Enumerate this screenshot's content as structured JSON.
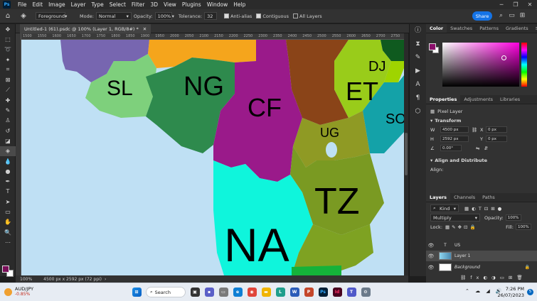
{
  "app": {
    "icon": "Ps",
    "menu": [
      "File",
      "Edit",
      "Image",
      "Layer",
      "Type",
      "Select",
      "Filter",
      "3D",
      "View",
      "Plugins",
      "Window",
      "Help"
    ]
  },
  "options": {
    "sample": "Foreground",
    "mode_label": "Mode:",
    "mode_value": "Normal",
    "opacity_label": "Opacity:",
    "opacity_value": "100%",
    "tolerance_label": "Tolerance:",
    "tolerance_value": "32",
    "antialias": "Anti-alias",
    "contiguous": "Contiguous",
    "all_layers": "All Layers",
    "share": "Share"
  },
  "document": {
    "tab_title": "Untitled-1 (61).psdc @ 100% (Layer 1, RGB/8#) *",
    "zoom": "100%",
    "info": "4500 px x 2592 px (72 ppi)"
  },
  "ruler_ticks": [
    "1500",
    "1550",
    "1600",
    "1650",
    "1700",
    "1750",
    "1800",
    "1850",
    "1900",
    "1950",
    "2000",
    "2050",
    "2100",
    "2150",
    "2200",
    "2250",
    "2300",
    "2350",
    "2400",
    "2450",
    "2500",
    "2550",
    "2600",
    "2650",
    "2700",
    "2750"
  ],
  "map_labels": [
    "SL",
    "NG",
    "CF",
    "ET",
    "DJ",
    "SO",
    "UG",
    "TZ",
    "NA"
  ],
  "colors": {
    "accent": "#1473e6",
    "foreground": "#8b0e6b",
    "background": "#ffffff"
  },
  "color_panel": {
    "tabs": [
      "Color",
      "Swatches",
      "Patterns",
      "Gradients"
    ]
  },
  "properties": {
    "tabs": [
      "Properties",
      "Adjustments",
      "Libraries"
    ],
    "layer_type": "Pixel Layer",
    "transform_label": "Transform",
    "w_label": "W",
    "w_value": "4500 px",
    "h_label": "H",
    "h_value": "2592 px",
    "x_label": "X",
    "x_value": "0 px",
    "y_label": "Y",
    "y_value": "0 px",
    "angle": "0.00°",
    "align_label": "Align and Distribute",
    "align_sub": "Align:"
  },
  "layers_panel": {
    "tabs": [
      "Layers",
      "Channels",
      "Paths"
    ],
    "kind": "Kind",
    "blend": "Multiply",
    "opacity_label": "Opacity:",
    "opacity_value": "100%",
    "lock_label": "Lock:",
    "fill_label": "Fill:",
    "fill_value": "100%",
    "items": [
      "US",
      "Layer 1",
      "Background"
    ]
  },
  "taskbar": {
    "ticker": "AUD/JPY",
    "change": "-0.85%",
    "search": "Search",
    "time": "7:26 PM",
    "date": "26/07/2023",
    "notifications": "5"
  }
}
